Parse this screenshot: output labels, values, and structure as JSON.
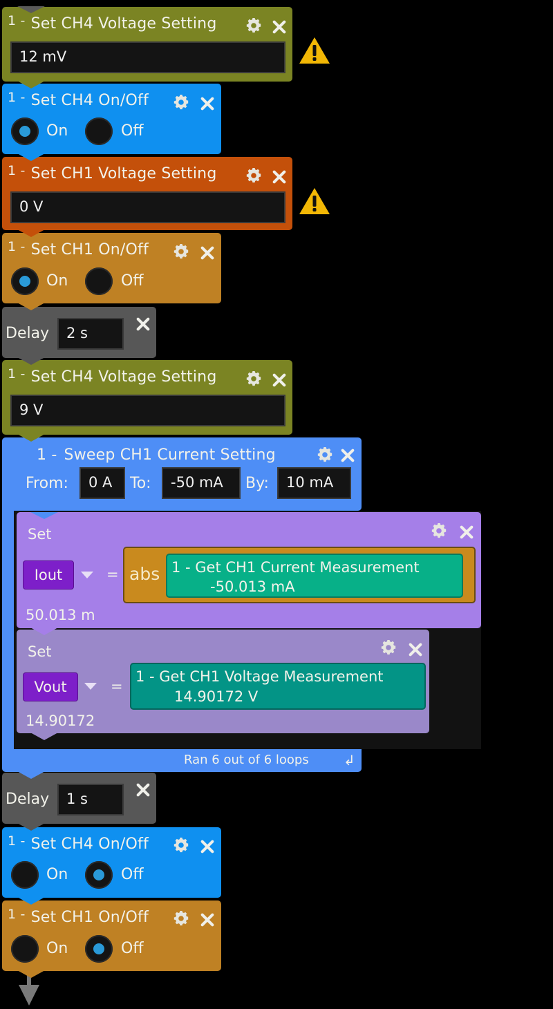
{
  "blocks": {
    "b1": {
      "index": "1 -",
      "title": "Set CH4 Voltage Setting",
      "value": "12 mV",
      "warning": true,
      "color": "#7b8423"
    },
    "b2": {
      "index": "1 -",
      "title": "Set CH4 On/Off",
      "on_label": "On",
      "off_label": "Off",
      "selected": "On",
      "color": "#0f90f0"
    },
    "b3": {
      "index": "1 -",
      "title": "Set CH1 Voltage Setting",
      "value": "0 V",
      "warning": true,
      "color": "#c4500a"
    },
    "b4": {
      "index": "1 -",
      "title": "Set CH1 On/Off",
      "on_label": "On",
      "off_label": "Off",
      "selected": "On",
      "color": "#bf8124"
    },
    "b5": {
      "label": "Delay",
      "value": "2 s",
      "color": "#575757"
    },
    "b6": {
      "index": "1 -",
      "title": "Set CH4 Voltage Setting",
      "value": "9 V",
      "color": "#7b8423"
    },
    "sweep": {
      "index": "1 -",
      "title": "Sweep CH1 Current Setting",
      "from_label": "From:",
      "from_value": "0 A",
      "to_label": "To:",
      "to_value": "-50 mA",
      "by_label": "By:",
      "by_value": "10 mA",
      "status": "Ran 6 out of 6 loops",
      "color": "#4e8ef6",
      "set1": {
        "label": "Set",
        "variable": "Iout",
        "equals": "=",
        "func": "abs",
        "get_title": "1 - Get CH1 Current Measurement",
        "get_value": "-50.013 mA",
        "result": "50.013 m",
        "color": "#a57fe8"
      },
      "set2": {
        "label": "Set",
        "variable": "Vout",
        "equals": "=",
        "get_title": "1 - Get CH1 Voltage Measurement",
        "get_value": "14.90172 V",
        "result": "14.90172",
        "color": "#9a88c9"
      }
    },
    "b8": {
      "label": "Delay",
      "value": "1 s",
      "color": "#575757"
    },
    "b9": {
      "index": "1 -",
      "title": "Set CH4 On/Off",
      "on_label": "On",
      "off_label": "Off",
      "selected": "Off",
      "color": "#0f90f0"
    },
    "b10": {
      "index": "1 -",
      "title": "Set CH1 On/Off",
      "on_label": "On",
      "off_label": "Off",
      "selected": "Off",
      "color": "#bf8124"
    }
  }
}
